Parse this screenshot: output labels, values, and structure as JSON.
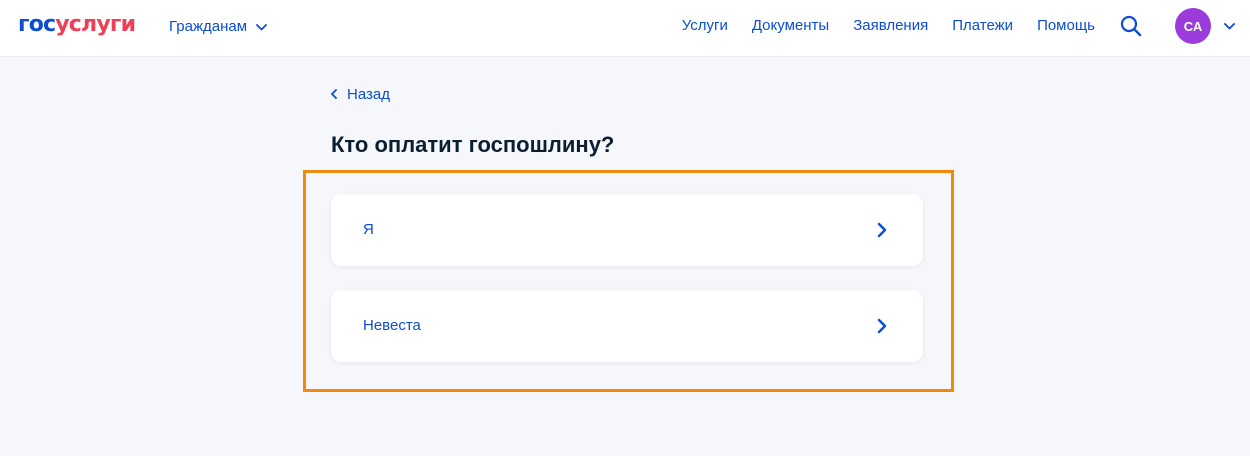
{
  "header": {
    "logo": {
      "part_a": "гос",
      "part_b": "услуги"
    },
    "role_selector": {
      "label": "Гражданам",
      "icon": "chevron-down-icon"
    },
    "nav": [
      {
        "label": "Услуги"
      },
      {
        "label": "Документы"
      },
      {
        "label": "Заявления"
      },
      {
        "label": "Платежи"
      },
      {
        "label": "Помощь"
      }
    ],
    "search_icon": "search-icon",
    "user": {
      "initials": "СА",
      "avatar_color": "#9c3bdc"
    }
  },
  "main": {
    "back_label": "Назад",
    "title": "Кто оплатит госпошлину?",
    "options": [
      {
        "label": "Я",
        "icon": "chevron-right-icon"
      },
      {
        "label": "Невеста",
        "icon": "chevron-right-icon"
      }
    ]
  },
  "colors": {
    "brand_blue": "#0d4cd3",
    "brand_red": "#ee3f58",
    "highlight": "#f08a0c",
    "background": "#f5f7fa",
    "text": "#0b1f33"
  }
}
